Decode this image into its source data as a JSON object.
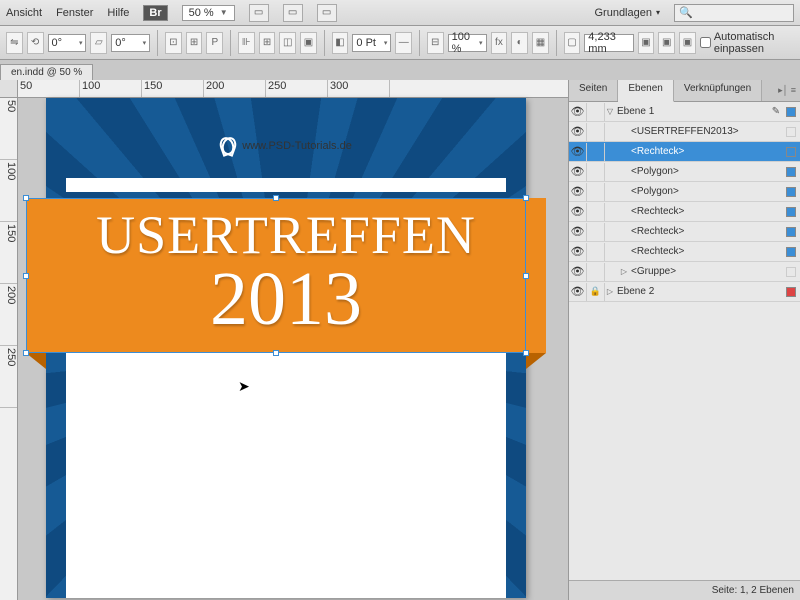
{
  "menubar": {
    "items": [
      "Ansicht",
      "Fenster",
      "Hilfe"
    ],
    "badge": "Br",
    "zoom": "50 %",
    "workspace": "Grundlagen",
    "search_placeholder": ""
  },
  "controlbar": {
    "angle1": "0°",
    "angle2": "0°",
    "stroke": "0 Pt",
    "scale": "100 %",
    "width": "4,233 mm",
    "autofit": "Automatisch einpassen"
  },
  "doc_tab": "en.indd @ 50 %",
  "ruler_h": [
    "50",
    "100",
    "150",
    "200",
    "250",
    "300"
  ],
  "ruler_v": [
    "50",
    "100",
    "150",
    "200",
    "250"
  ],
  "page": {
    "url": "www.PSD-Tutorials.de",
    "banner_title": "USERTREFFEN",
    "banner_year": "2013"
  },
  "panel": {
    "tabs": [
      "Seiten",
      "Ebenen",
      "Verknüpfungen"
    ],
    "layers": [
      {
        "eye": true,
        "lock": false,
        "indent": 0,
        "arrow": "▽",
        "name": "Ebene 1",
        "sw": "#3b8ed6",
        "pen": true,
        "sel": false
      },
      {
        "eye": true,
        "lock": false,
        "indent": 1,
        "arrow": "",
        "name": "<USERTREFFEN2013>",
        "sw": "",
        "sel": false
      },
      {
        "eye": true,
        "lock": false,
        "indent": 1,
        "arrow": "",
        "name": "<Rechteck>",
        "sw": "#3b8ed6",
        "sel": true
      },
      {
        "eye": true,
        "lock": false,
        "indent": 1,
        "arrow": "",
        "name": "<Polygon>",
        "sw": "#3b8ed6",
        "sel": false
      },
      {
        "eye": true,
        "lock": false,
        "indent": 1,
        "arrow": "",
        "name": "<Polygon>",
        "sw": "#3b8ed6",
        "sel": false
      },
      {
        "eye": true,
        "lock": false,
        "indent": 1,
        "arrow": "",
        "name": "<Rechteck>",
        "sw": "#3b8ed6",
        "sel": false
      },
      {
        "eye": true,
        "lock": false,
        "indent": 1,
        "arrow": "",
        "name": "<Rechteck>",
        "sw": "#3b8ed6",
        "sel": false
      },
      {
        "eye": true,
        "lock": false,
        "indent": 1,
        "arrow": "",
        "name": "<Rechteck>",
        "sw": "#3b8ed6",
        "sel": false
      },
      {
        "eye": true,
        "lock": false,
        "indent": 1,
        "arrow": "▷",
        "name": "<Gruppe>",
        "sw": "",
        "sel": false
      },
      {
        "eye": true,
        "lock": true,
        "indent": 0,
        "arrow": "▷",
        "name": "Ebene 2",
        "sw": "#d44",
        "pen": false,
        "sel": false
      }
    ],
    "status": "Seite: 1, 2 Ebenen"
  }
}
